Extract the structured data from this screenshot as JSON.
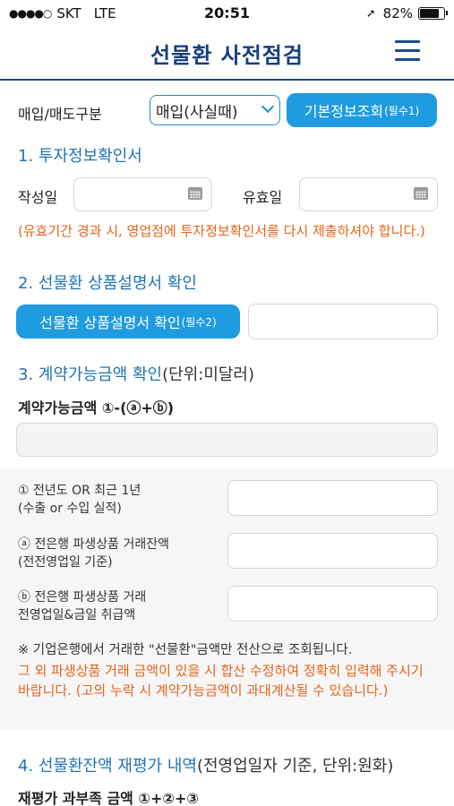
{
  "status_bar": {
    "carrier": "SKT",
    "network": "LTE",
    "time": "20:51",
    "battery": "82%",
    "battery_level": 0.82
  },
  "header": {
    "title": "선물환 사전점검",
    "menu_icon": "hamburger-menu-icon"
  },
  "buy_sell": {
    "label": "매입/매도구분",
    "select_value": "매입(사실때)",
    "lookup_button": "기본정보조회",
    "lookup_required": "(필수1)"
  },
  "section1": {
    "title": "1. 투자정보확인서",
    "write_date_label": "작성일",
    "valid_date_label": "유효일",
    "calendar_icon": "calendar-icon",
    "warning": "(유효기간 경과 시, 영업점에 투자정보확인서를 다시 제출하셔야 합니다.)"
  },
  "section2": {
    "title": "2. 선물환 상품설명서 확인",
    "confirm_button": "선물환 상품설명서 확인",
    "confirm_required": "(필수2)"
  },
  "section3": {
    "title": "3. 계약가능금액 확인",
    "unit": "(단위:미달러)",
    "amount_label": "계약가능금액 ①-(ⓐ+ⓑ)",
    "item1_line1": "① 전년도 OR 최근 1년",
    "item1_line2": "(수출 or 수입 실적)",
    "itemA_line1": "ⓐ 전은행 파생상품 거래잔액",
    "itemA_line2": "(전전영업일 기준)",
    "itemB_line1": "ⓑ 전은행 파생상품 거래",
    "itemB_line2": "전영업일&금일 취급액",
    "note": "※ 기업은행에서 거래한 \"선물환\"금액만 전산으로 조회됩니다.",
    "warning": "그 외 파생상품 거래 금액이 있을 시 합산 수정하여 정확히 입력해 주시기 바랍니다. (고의 누락 시 계약가능금액이 과대계산될 수 있습니다.)"
  },
  "section4": {
    "title": "4. 선물환잔액 재평가 내역",
    "unit": "(전영업일자 기준, 단위:원화)",
    "shortfall_label": "재평가 과부족 금액 ①+②+③"
  }
}
